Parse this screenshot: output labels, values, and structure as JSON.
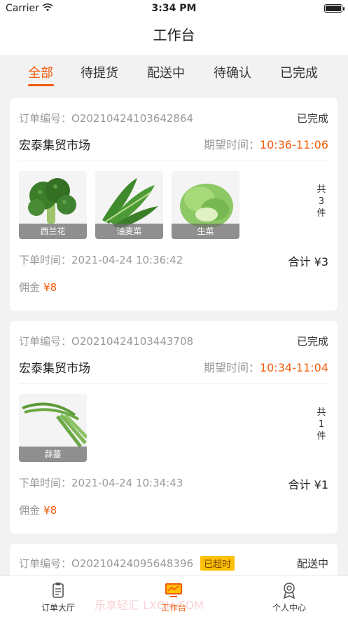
{
  "status_bar": {
    "carrier": "Carrier",
    "time": "3:34 PM"
  },
  "nav": {
    "title": "工作台"
  },
  "tabs": [
    {
      "label": "全部",
      "active": true
    },
    {
      "label": "待提货",
      "active": false
    },
    {
      "label": "配送中",
      "active": false
    },
    {
      "label": "待确认",
      "active": false
    },
    {
      "label": "已完成",
      "active": false
    }
  ],
  "labels": {
    "order_no": "订单编号：",
    "expected_time": "期望时间：",
    "order_time": "下单时间：",
    "total": "合计",
    "commission": "佣金",
    "count_prefix": "共",
    "count_suffix": "件"
  },
  "orders": [
    {
      "order_no": "O20210424103642864",
      "status": "已完成",
      "market": "宏泰集贸市场",
      "expected_time": "10:36-11:06",
      "items": [
        {
          "name": "西兰花",
          "icon": "broccoli-image"
        },
        {
          "name": "油麦菜",
          "icon": "lettuce-leaf-image"
        },
        {
          "name": "生菜",
          "icon": "romaine-image"
        }
      ],
      "count": "3",
      "order_time": "2021-04-24 10:36:42",
      "total": "¥3",
      "commission": "¥8"
    },
    {
      "order_no": "O20210424103443708",
      "status": "已完成",
      "market": "宏泰集贸市场",
      "expected_time": "10:34-11:04",
      "items": [
        {
          "name": "蒜薹",
          "icon": "garlic-scape-image"
        }
      ],
      "count": "1",
      "order_time": "2021-04-24 10:34:43",
      "total": "¥1",
      "commission": "¥8"
    },
    {
      "order_no": "O20210424095648396",
      "badge": "已超时",
      "status": "配送中"
    }
  ],
  "bottom_tabs": [
    {
      "label": "订单大厅",
      "icon": "clipboard-icon",
      "active": false
    },
    {
      "label": "工作台",
      "icon": "workbench-icon",
      "active": true
    },
    {
      "label": "个人中心",
      "icon": "person-badge-icon",
      "active": false
    }
  ],
  "watermark": "乐享轻汇 LXQH.COM",
  "colors": {
    "accent": "#f25a0a",
    "badge": "#ffc107"
  }
}
